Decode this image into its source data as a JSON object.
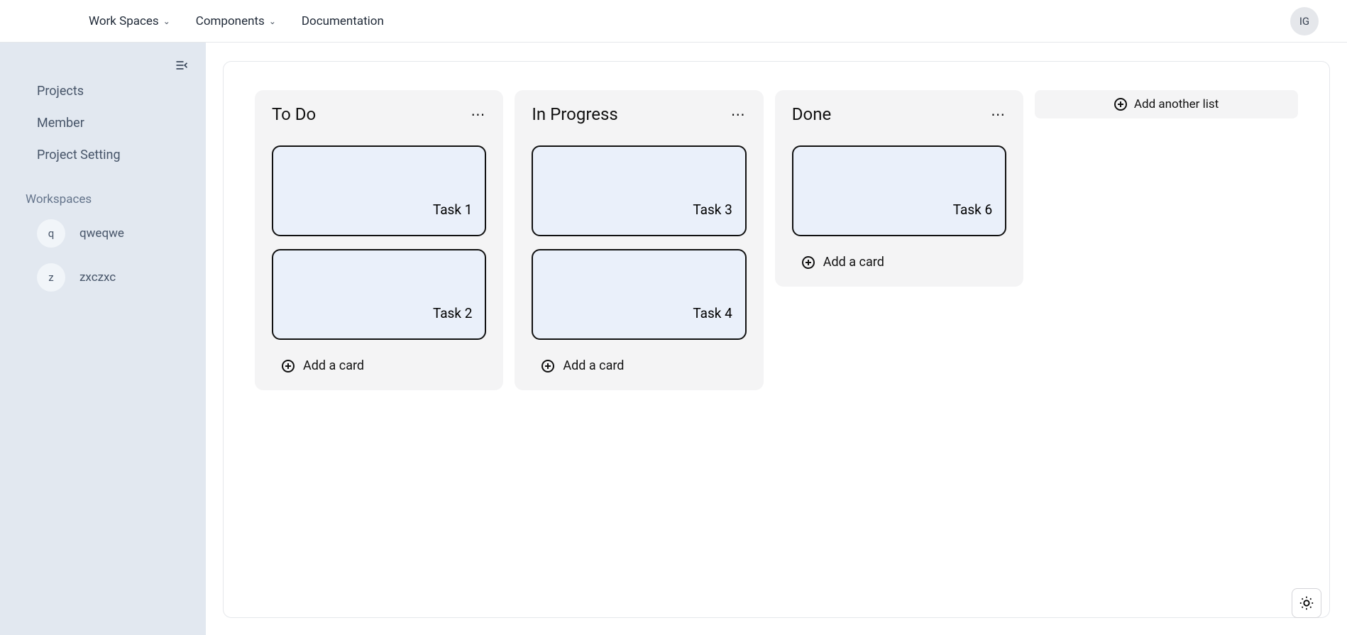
{
  "topnav": {
    "items": [
      {
        "label": "Work Spaces",
        "has_chevron": true
      },
      {
        "label": "Components",
        "has_chevron": true
      },
      {
        "label": "Documentation",
        "has_chevron": false
      }
    ],
    "user_avatar": "IG"
  },
  "sidebar": {
    "nav": [
      {
        "label": "Projects"
      },
      {
        "label": "Member"
      },
      {
        "label": "Project Setting"
      }
    ],
    "section_title": "Workspaces",
    "workspaces": [
      {
        "initial": "q",
        "name": "qweqwe"
      },
      {
        "initial": "z",
        "name": "zxczxc"
      }
    ]
  },
  "board": {
    "columns": [
      {
        "title": "To Do",
        "cards": [
          {
            "title": "Task 1"
          },
          {
            "title": "Task 2"
          }
        ],
        "add_card_label": "Add a card"
      },
      {
        "title": "In Progress",
        "cards": [
          {
            "title": "Task 3"
          },
          {
            "title": "Task 4"
          }
        ],
        "add_card_label": "Add a card"
      },
      {
        "title": "Done",
        "cards": [
          {
            "title": "Task 6"
          }
        ],
        "add_card_label": "Add a card"
      }
    ],
    "add_list_label": "Add another list"
  }
}
